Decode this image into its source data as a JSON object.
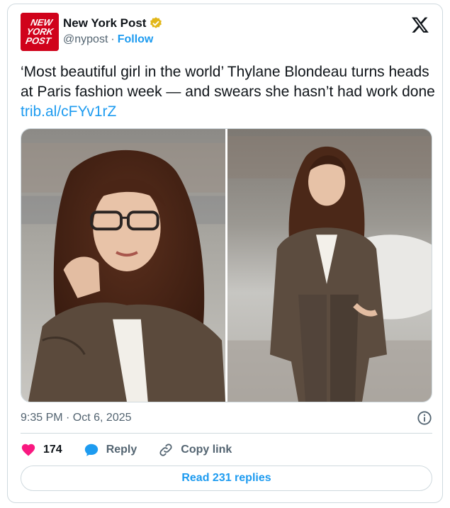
{
  "account": {
    "display_name": "New York Post",
    "handle": "@nypost",
    "separator": "·",
    "follow_label": "Follow",
    "avatar_text_line1": "NEW",
    "avatar_text_line2": "YORK",
    "avatar_text_line3": "POST",
    "avatar_color": "#d0021b",
    "verified_badge_color": "#e2b719"
  },
  "tweet": {
    "text": "‘Most beautiful girl in the world’ Thylane Blondeau turns heads at Paris fashion week — and swears she hasn’t had work done ",
    "link_text": "trib.al/cFYv1rZ",
    "timestamp": "9:35 PM · Oct 6, 2025"
  },
  "media": {
    "photos": [
      {
        "subject": "woman adjusting glasses, brown tweed blazer"
      },
      {
        "subject": "woman in brown tweed suit, hand in pocket"
      }
    ]
  },
  "actions": {
    "likes_count": "174",
    "reply_label": "Reply",
    "copy_link_label": "Copy link",
    "read_replies_label": "Read 231 replies"
  },
  "colors": {
    "accent": "#1d9bf0",
    "like": "#f91880",
    "secondary_text": "#536471",
    "border": "#cfd9de"
  }
}
